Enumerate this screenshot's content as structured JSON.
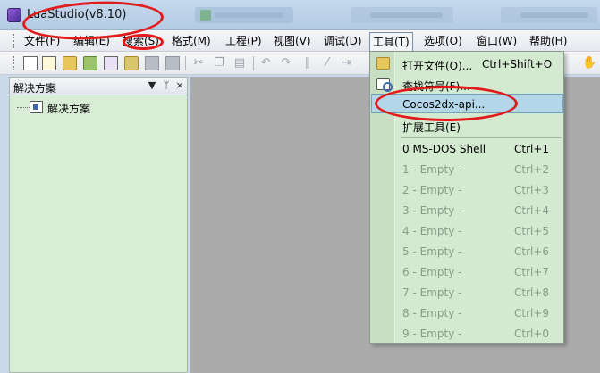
{
  "app": {
    "title": "LuaStudio(v8.10)",
    "icon": "luastudio-app-icon"
  },
  "menubar": {
    "items": [
      "文件(F)",
      "编辑(E)",
      "搜索(S)",
      "格式(M)",
      "工程(P)",
      "视图(V)",
      "调试(D)",
      "工具(T)",
      "选项(O)",
      "窗口(W)",
      "帮助(H)"
    ],
    "active_index": 7
  },
  "toolbar": {
    "icons": [
      "new-file-icon",
      "new-project-icon",
      "open-folder-icon",
      "open-project-icon",
      "properties-icon",
      "tree-icon",
      "save-icon",
      "save-all-icon",
      "cut-icon",
      "copy-icon",
      "paste-icon",
      "undo-icon",
      "redo-icon",
      "comment-icon",
      "uncomment-icon",
      "indent-icon",
      "hand-icon"
    ]
  },
  "solution_panel": {
    "title": "解决方案",
    "controls": [
      "▼",
      "ᛘ",
      "×"
    ],
    "tree": [
      {
        "label": "解决方案",
        "icon": "solution-icon"
      }
    ]
  },
  "tools_menu": {
    "items": [
      {
        "label": "打开文件(O)...",
        "shortcut": "Ctrl+Shift+O",
        "icon": "open-file-icon",
        "enabled": true
      },
      {
        "label": "查找符号(F)...",
        "shortcut": "",
        "icon": "find-symbol-icon",
        "enabled": true
      },
      {
        "label": "Cocos2dx-api...",
        "shortcut": "",
        "icon": "",
        "enabled": true,
        "highlighted": true
      },
      {
        "label": "扩展工具(E)",
        "shortcut": "",
        "icon": "",
        "enabled": true
      },
      {
        "label": "0 MS-DOS Shell",
        "shortcut": "Ctrl+1",
        "enabled": true
      },
      {
        "label": "1 - Empty -",
        "shortcut": "Ctrl+2",
        "enabled": false
      },
      {
        "label": "2 - Empty -",
        "shortcut": "Ctrl+3",
        "enabled": false
      },
      {
        "label": "3 - Empty -",
        "shortcut": "Ctrl+4",
        "enabled": false
      },
      {
        "label": "4 - Empty -",
        "shortcut": "Ctrl+5",
        "enabled": false
      },
      {
        "label": "5 - Empty -",
        "shortcut": "Ctrl+6",
        "enabled": false
      },
      {
        "label": "6 - Empty -",
        "shortcut": "Ctrl+7",
        "enabled": false
      },
      {
        "label": "7 - Empty -",
        "shortcut": "Ctrl+8",
        "enabled": false
      },
      {
        "label": "8 - Empty -",
        "shortcut": "Ctrl+9",
        "enabled": false
      },
      {
        "label": "9 - Empty -",
        "shortcut": "Ctrl+0",
        "enabled": false
      }
    ]
  },
  "colors": {
    "menu_background": "#d3ead0",
    "highlight": "#b3d6e8",
    "annotation": "#e11b1b",
    "workspace": "#ababab"
  }
}
